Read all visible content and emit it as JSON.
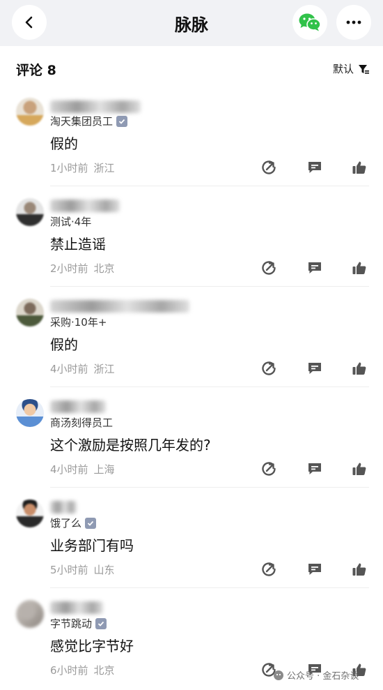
{
  "nav": {
    "title": "脉脉",
    "back_icon": "chevron-left-icon",
    "wechat_icon": "wechat-icon",
    "more_icon": "ellipsis-icon"
  },
  "comments_header": {
    "title": "评论 8",
    "sort_label": "默认",
    "sort_icon": "filter-icon"
  },
  "comments": [
    {
      "org": "淘天集团员工",
      "verified": true,
      "text": "假的",
      "time": "1小时前",
      "location": "浙江"
    },
    {
      "org": "测试·4年",
      "verified": false,
      "text": "禁止造谣",
      "time": "2小时前",
      "location": "北京"
    },
    {
      "org": "采购·10年+",
      "verified": false,
      "text": "假的",
      "time": "4小时前",
      "location": "浙江"
    },
    {
      "org": "商汤刻得员工",
      "verified": false,
      "text": "这个激励是按照几年发的?",
      "time": "4小时前",
      "location": "上海"
    },
    {
      "org": "饿了么",
      "verified": true,
      "text": "业务部门有吗",
      "time": "5小时前",
      "location": "山东"
    },
    {
      "org": "字节跳动",
      "verified": true,
      "text": "感觉比字节好",
      "time": "6小时前",
      "location": "北京"
    }
  ],
  "actions": {
    "share_icon": "share-arrow-icon",
    "reply_icon": "comment-bubble-icon",
    "like_icon": "thumbs-up-icon"
  },
  "watermark": {
    "text": "公众号 · 金石杂谈",
    "icon": "wechat-official-icon"
  },
  "colors": {
    "accent_green": "#31c24a",
    "verified_badge": "#8f9ab3",
    "meta_gray": "#9a9a9a",
    "topbar_bg": "#f1f2f5"
  }
}
